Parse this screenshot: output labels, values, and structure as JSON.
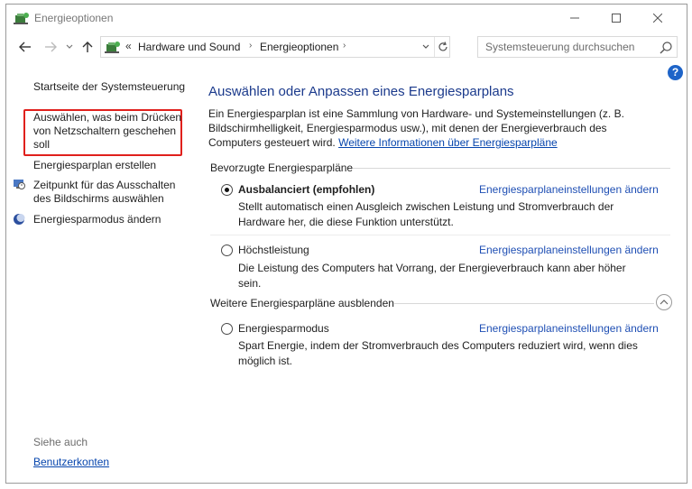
{
  "window": {
    "title": "Energieoptionen"
  },
  "navigation": {
    "breadcrumb_prefix": "«",
    "breadcrumbs": [
      "Hardware und Sound",
      "Energieoptionen"
    ],
    "search_placeholder": "Systemsteuerung durchsuchen"
  },
  "help": {
    "label": "?"
  },
  "sidebar": {
    "items": [
      {
        "label": "Startseite der Systemsteuerung"
      },
      {
        "label": "Auswählen, was beim Drücken von Netzschaltern geschehen soll",
        "lines": [
          "Auswählen, was beim Drücken",
          "von Netzschaltern geschehen",
          "soll"
        ]
      },
      {
        "label": "Energiesparplan erstellen"
      },
      {
        "label": "Zeitpunkt für das Ausschalten des Bildschirms auswählen",
        "lines": [
          "Zeitpunkt für das Ausschalten",
          "des Bildschirms auswählen"
        ]
      },
      {
        "label": "Energiesparmodus ändern"
      }
    ],
    "see_also_heading": "Siehe auch",
    "see_also_link": "Benutzerkonten"
  },
  "main": {
    "title": "Auswählen oder Anpassen eines Energiesparplans",
    "intro_text": "Ein Energiesparplan ist eine Sammlung von Hardware- und Systemeinstellungen (z. B. Bildschirmhelligkeit, Energiesparmodus usw.), mit denen der Energieverbrauch des Computers gesteuert wird.",
    "intro_link": "Weitere Informationen über Energiesparpläne",
    "preferred_heading": "Bevorzugte Energiesparpläne",
    "more_heading": "Weitere Energiesparpläne ausblenden",
    "plans": [
      {
        "name": "Ausbalanciert (empfohlen)",
        "selected": true,
        "link": "Energiesparplaneinstellungen ändern",
        "description": "Stellt automatisch einen Ausgleich zwischen Leistung und Stromverbrauch der Hardware her, die diese Funktion unterstützt."
      },
      {
        "name": "Höchstleistung",
        "selected": false,
        "link": "Energiesparplaneinstellungen ändern",
        "description": "Die Leistung des Computers hat Vorrang, der Energieverbrauch kann aber höher sein."
      },
      {
        "name": "Energiesparmodus",
        "selected": false,
        "link": "Energiesparplaneinstellungen ändern",
        "description": "Spart Energie, indem der Stromverbrauch des Computers reduziert wird, wenn dies möglich ist."
      }
    ]
  },
  "colors": {
    "highlight_border": "#e0201c",
    "title_blue": "#1b3a8c",
    "link_blue": "#1f4fb4"
  }
}
